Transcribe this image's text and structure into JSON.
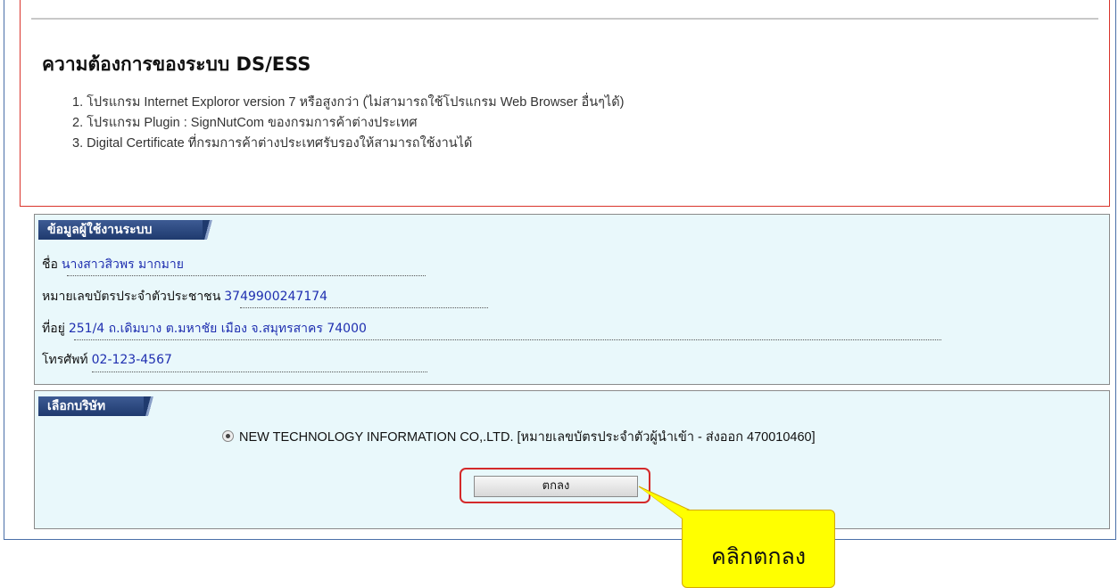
{
  "requirements": {
    "title": "ความต้องการของระบบ DS/ESS",
    "items": [
      "1. โปรแกรม Internet Exploror version 7 หรือสูงกว่า (ไม่สามารถใช้โปรแกรม Web Browser อื่นๆได้)",
      "2. โปรแกรม Plugin : SignNutCom ของกรมการค้าต่างประเทศ",
      "3. Digital Certificate ที่กรมการค้าต่างประเทศรับรองให้สามารถใช้งานได้"
    ]
  },
  "user_info": {
    "header": "ข้อมูลผู้ใช้งานระบบ",
    "name_label": "ชื่อ",
    "name_value": "นางสาวสิวพร มากมาย",
    "id_label": "หมายเลขบัตรประจำตัวประชาชน",
    "id_value": "3749900247174",
    "address_label": "ที่อยู่",
    "address_value": "251/4 ถ.เดิมบาง ต.มหาชัย เมือง จ.สมุทรสาคร 74000",
    "phone_label": "โทรศัพท์",
    "phone_value": "02-123-4567"
  },
  "company": {
    "header": "เลือกบริษัท",
    "option": "NEW TECHNOLOGY INFORMATION CO,.LTD. [หมายเลขบัตรประจำตัวผู้นำเข้า - ส่งออก 470010460]",
    "option_selected": true,
    "ok_label": "ตกลง"
  },
  "callout": {
    "text": "คลิกตกลง",
    "color": "#ffff00"
  },
  "colors": {
    "header_bg": "#1f3a6e",
    "panel_bg": "#e9f8fb",
    "value_text": "#1f2fb0",
    "highlight_border": "#d42a2a"
  }
}
